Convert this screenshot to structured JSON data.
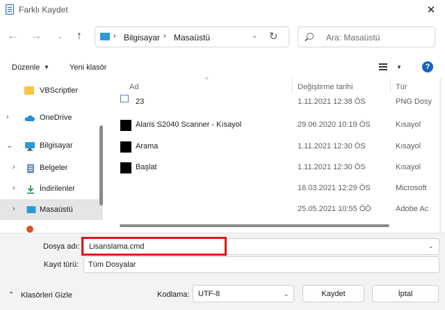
{
  "window": {
    "title": "Farklı Kaydet",
    "close_glyph": "✕"
  },
  "nav": {
    "back_glyph": "←",
    "forward_glyph": "→",
    "recent_glyph": "⌄",
    "up_glyph": "↑"
  },
  "address": {
    "separator": "›",
    "crumbs": [
      "Bilgisayar",
      "Masaüstü"
    ],
    "dropdown_glyph": "⌄",
    "refresh_glyph": "↻"
  },
  "search": {
    "placeholder": "Ara: Masaüstü"
  },
  "commandbar": {
    "organize_label": "Düzenle",
    "organize_caret": "▼",
    "new_folder_label": "Yeni klasör",
    "view_caret": "▼",
    "help_glyph": "?"
  },
  "sidebar": {
    "items": [
      {
        "label": "VBScriptler",
        "icon": "folder-icon",
        "chevron": ""
      },
      {
        "label": "OneDrive",
        "icon": "cloud-icon",
        "chevron": "›"
      },
      {
        "label": "Bilgisayar",
        "icon": "computer-icon",
        "chevron": "⌄"
      },
      {
        "label": "Belgeler",
        "icon": "documents-icon",
        "chevron": "›"
      },
      {
        "label": "İndirilenler",
        "icon": "downloads-icon",
        "chevron": "›"
      },
      {
        "label": "Masaüstü",
        "icon": "desktop-icon",
        "chevron": "›"
      }
    ]
  },
  "files": {
    "headers": {
      "name": "Ad",
      "date": "Değiştirme tarihi",
      "type": "Tür",
      "sort_glyph": "^"
    },
    "rows": [
      {
        "name": "23",
        "date": "1.11.2021 12:38 ÖS",
        "type": "PNG Dosy",
        "icon": "image-file-icon"
      },
      {
        "name": "Alaris S2040 Scanner - Kısayol",
        "date": "29.06.2020 10:19 ÖS",
        "type": "Kısayol",
        "icon": "shortcut-icon"
      },
      {
        "name": "Arama",
        "date": "1.11.2021 12:30 ÖS",
        "type": "Kısayol",
        "icon": "shortcut-icon"
      },
      {
        "name": "Başlat",
        "date": "1.11.2021 12:30 ÖS",
        "type": "Kısayol",
        "icon": "shortcut-icon"
      },
      {
        "name": "",
        "date": "16.03.2021 12:29 ÖS",
        "type": "Microsoft",
        "icon": ""
      },
      {
        "name": "",
        "date": "25.05.2021 10:55 ÖÖ",
        "type": "Adobe Ac",
        "icon": ""
      }
    ]
  },
  "form": {
    "filename_label": "Dosya adı:",
    "filename_value": "Lisanslama.cmd",
    "filename_dropdown_glyph": "⌄",
    "savetype_label": "Kayıt türü:",
    "savetype_value": "Tüm Dosyalar",
    "hide_folders_glyph": "⌃",
    "hide_folders_label": "Klasörleri Gizle",
    "encoding_label": "Kodlama:",
    "encoding_value": "UTF-8",
    "encoding_caret": "⌄",
    "save_label": "Kaydet",
    "cancel_label": "İptal"
  },
  "colors": {
    "highlight": "#e0141a",
    "help": "#1565c0",
    "onedrive": "#1e8fd8",
    "desktop": "#2a9bd6",
    "folder": "#f5c542"
  }
}
